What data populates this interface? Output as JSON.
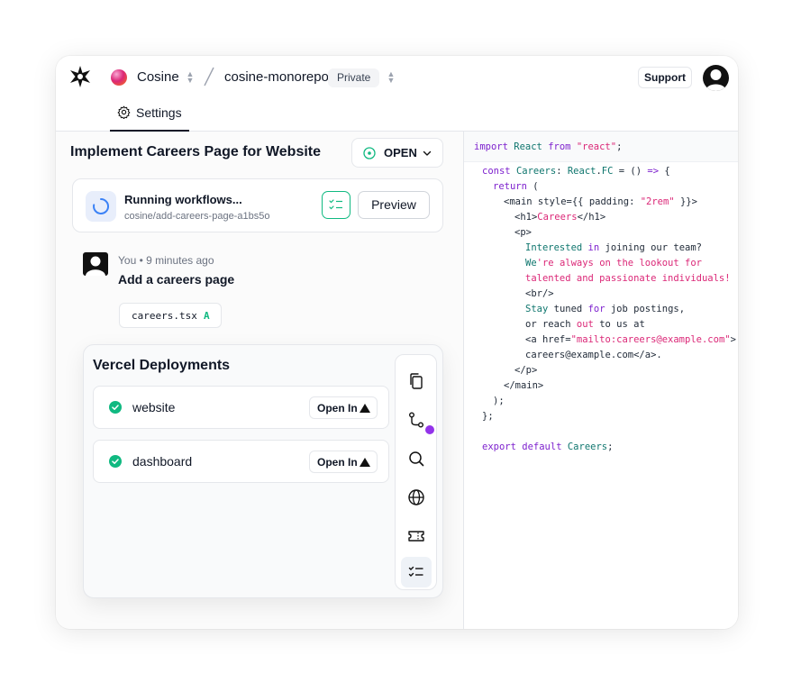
{
  "header": {
    "org_name": "Cosine",
    "repo_name": "cosine-monorepo",
    "visibility_badge": "Private",
    "support_label": "Support"
  },
  "tabs": {
    "settings_label": "Settings"
  },
  "task": {
    "title": "Implement Careers Page for Website",
    "status_label": "OPEN"
  },
  "workflow": {
    "title": "Running workflows...",
    "branch": "cosine/add-careers-page-a1bs5o",
    "preview_label": "Preview"
  },
  "message": {
    "meta": "You • 9 minutes ago",
    "text": "Add a careers page",
    "file_name": "careers.tsx",
    "file_status": "A"
  },
  "vercel": {
    "title": "Vercel Deployments",
    "deployments": [
      {
        "name": "website",
        "button": "Open In",
        "status": "success"
      },
      {
        "name": "dashboard",
        "button": "Open In",
        "status": "success"
      }
    ]
  },
  "tool_rail": {
    "icons": [
      "files-icon",
      "git-compare-icon",
      "search-icon",
      "globe-icon",
      "ticket-icon",
      "checklist-icon"
    ],
    "active": "checklist-icon"
  },
  "code": {
    "lines": [
      "import React from \"react\";",
      "const Careers: React.FC = () => {",
      "  return (",
      "    <main style={{ padding: \"2rem\" }}>",
      "      <h1>Careers</h1>",
      "      <p>",
      "        Interested in joining our team?",
      "        We're always on the lookout for",
      "        talented and passionate individuals!",
      "        <br/>",
      "        Stay tuned for job postings,",
      "        or reach out to us at",
      "        <a href=\"mailto:careers@example.com\">",
      "        careers@example.com</a>.",
      "      </p>",
      "    </main>",
      "  );",
      "};",
      "export default Careers;"
    ]
  },
  "colors": {
    "accent_green": "#10b981",
    "notify_purple": "#9333ea",
    "code_keyword": "#7e22ce",
    "code_type": "#0f766e",
    "code_string": "#db2777"
  }
}
